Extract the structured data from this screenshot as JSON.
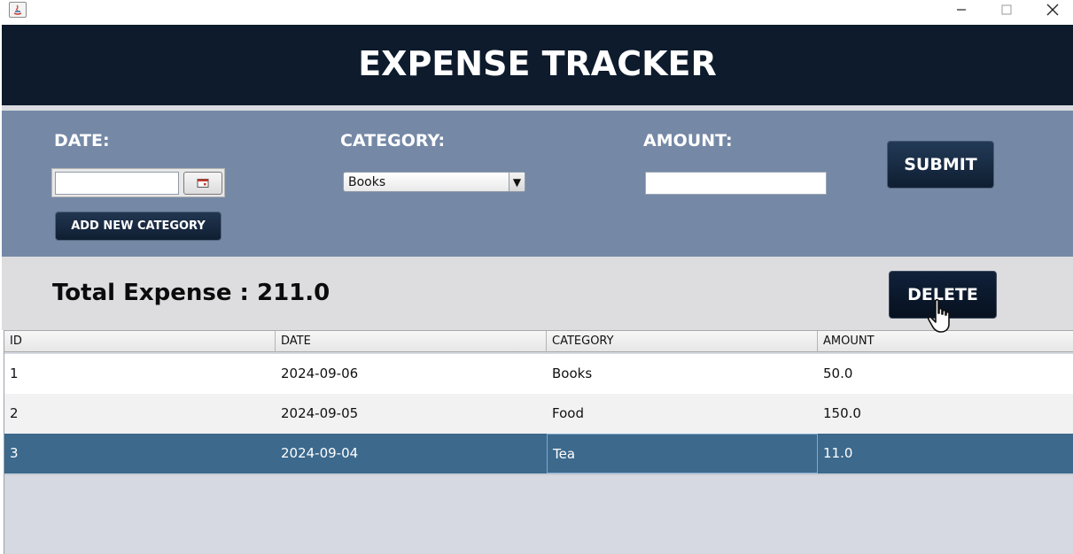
{
  "window": {
    "minimize_glyph": "—",
    "maximize_glyph": "☐",
    "close_glyph": "✕",
    "icon": "java-app-icon"
  },
  "header": {
    "title": "EXPENSE TRACKER"
  },
  "form": {
    "date_label": "DATE:",
    "date_value": "",
    "calendar_icon": "calendar-icon",
    "category_label": "CATEGORY:",
    "category_selected": "Books",
    "amount_label": "AMOUNT:",
    "amount_value": "",
    "add_category_label": "ADD NEW CATEGORY",
    "submit_label": "SUBMIT"
  },
  "summary": {
    "total_text": "Total Expense : 211.0",
    "delete_label": "DELETE"
  },
  "table": {
    "columns": [
      "ID",
      "DATE",
      "CATEGORY",
      "AMOUNT"
    ],
    "rows": [
      [
        "1",
        "2024-09-06",
        "Books",
        "50.0"
      ],
      [
        "2",
        "2024-09-05",
        "Food",
        "150.0"
      ],
      [
        "3",
        "2024-09-04",
        "Tea",
        "11.0"
      ]
    ],
    "selected_row_index": 2
  },
  "colors": {
    "header_bg": "#0d1b2c",
    "form_bg": "#7589a6",
    "summary_bg": "#dddddf",
    "selected_row": "#3c698c"
  }
}
